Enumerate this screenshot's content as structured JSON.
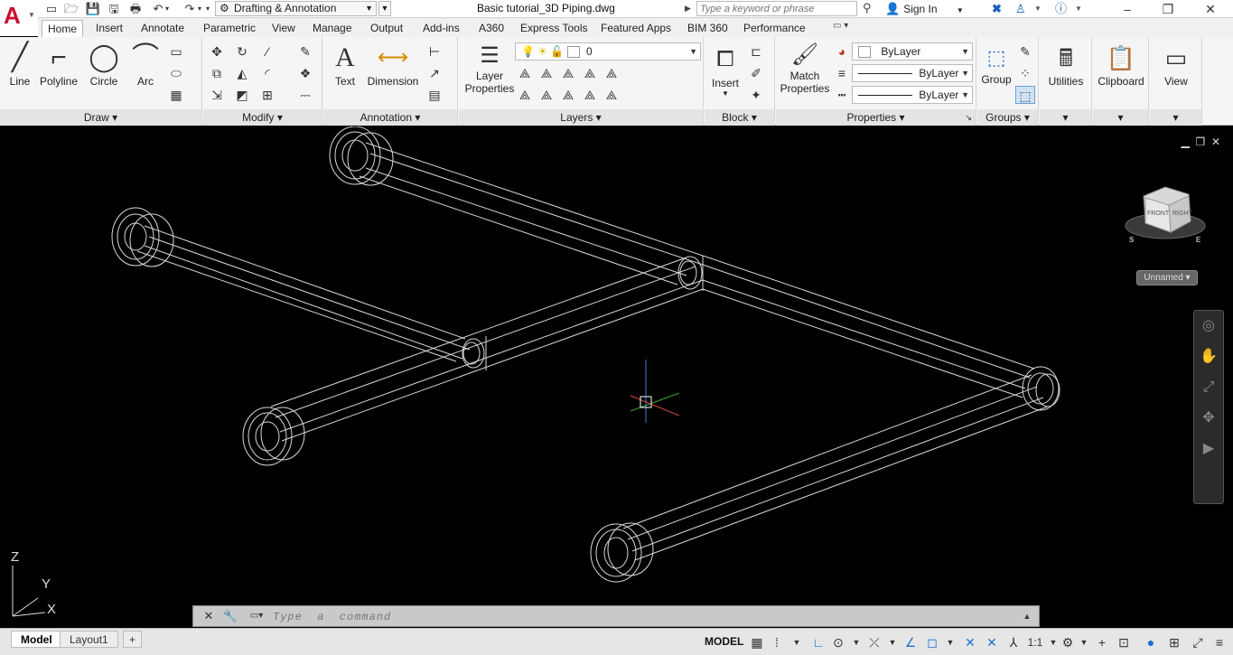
{
  "app": {
    "logo_letter": "A",
    "document_title": "Basic tutorial_3D Piping.dwg"
  },
  "quick_access": {
    "workspace": "Drafting & Annotation"
  },
  "search": {
    "placeholder": "Type a keyword or phrase"
  },
  "account": {
    "sign_in_label": "Sign In"
  },
  "ribbon_tabs": [
    "Home",
    "Insert",
    "Annotate",
    "Parametric",
    "View",
    "Manage",
    "Output",
    "Add-ins",
    "A360",
    "Express Tools",
    "Featured Apps",
    "BIM 360",
    "Performance"
  ],
  "active_tab": "Home",
  "panels": {
    "draw": {
      "title": "Draw",
      "line": "Line",
      "polyline": "Polyline",
      "circle": "Circle",
      "arc": "Arc"
    },
    "modify": {
      "title": "Modify"
    },
    "annotation": {
      "title": "Annotation",
      "text": "Text",
      "dimension": "Dimension"
    },
    "layers": {
      "title": "Layers",
      "layer_properties_1": "Layer",
      "layer_properties_2": "Properties",
      "current_layer": "0"
    },
    "block": {
      "title": "Block",
      "insert": "Insert"
    },
    "properties": {
      "title": "Properties",
      "match_1": "Match",
      "match_2": "Properties",
      "color": "ByLayer",
      "linetype": "ByLayer",
      "lineweight": "ByLayer"
    },
    "groups": {
      "title": "Groups",
      "group": "Group"
    },
    "utilities": {
      "title": "Utilities"
    },
    "clipboard": {
      "title": "Clipboard"
    },
    "view": {
      "title": "View"
    }
  },
  "viewcube": {
    "front": "FRONT",
    "right": "RIGHT",
    "south": "S",
    "east": "E",
    "named_view": "Unnamed"
  },
  "ucs": {
    "z": "Z",
    "y": "Y",
    "x": "X"
  },
  "command_line": {
    "placeholder": "Type  a  command"
  },
  "layout_tabs": [
    "Model",
    "Layout1"
  ],
  "status": {
    "space": "MODEL",
    "scale": "1:1"
  }
}
